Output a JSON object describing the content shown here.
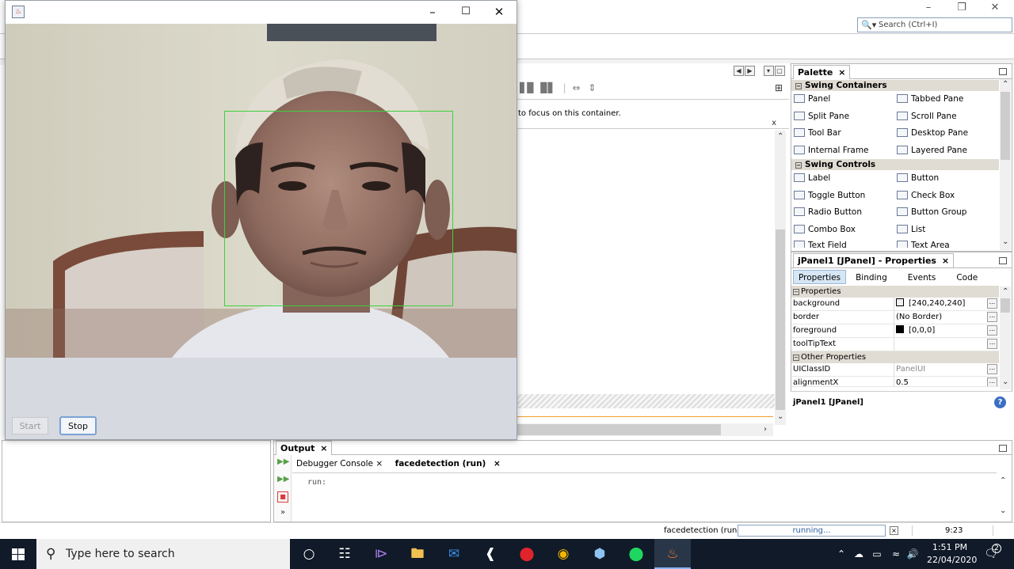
{
  "ide": {
    "search_placeholder": "Search (Ctrl+I)",
    "editor_hint": "to focus on this container.",
    "editor_hint_close": "x",
    "palette": {
      "title": "Palette",
      "close": "×",
      "categories": [
        {
          "name": "Swing Containers",
          "items": [
            "Panel",
            "Tabbed Pane",
            "Split Pane",
            "Scroll Pane",
            "Tool Bar",
            "Desktop Pane",
            "Internal Frame",
            "Layered Pane"
          ]
        },
        {
          "name": "Swing Controls",
          "items": [
            "Label",
            "Button",
            "Toggle Button",
            "Check Box",
            "Radio Button",
            "Button Group",
            "Combo Box",
            "List",
            "Text Field",
            "Text Area"
          ]
        }
      ]
    },
    "properties": {
      "title": "jPanel1 [JPanel] - Properties",
      "close": "×",
      "tabs": [
        "Properties",
        "Binding",
        "Events",
        "Code"
      ],
      "group1": "Properties",
      "rows1": [
        {
          "key": "background",
          "value": "[240,240,240]",
          "swatch": "#f0f0f0"
        },
        {
          "key": "border",
          "value": "(No Border)"
        },
        {
          "key": "foreground",
          "value": "[0,0,0]",
          "swatch": "#000000"
        },
        {
          "key": "toolTipText",
          "value": ""
        }
      ],
      "group2": "Other Properties",
      "rows2": [
        {
          "key": "UIClassID",
          "value": "PanelUI"
        },
        {
          "key": "alignmentX",
          "value": "0.5"
        }
      ],
      "footer": "jPanel1 [JPanel]",
      "dots": "..."
    },
    "output": {
      "title": "Output",
      "close": "×",
      "tabs": [
        "Debugger Console",
        "facedetection (run)"
      ],
      "text": "run:"
    },
    "status": {
      "task": "facedetection (run)",
      "progress": "running...",
      "position": "9:23"
    }
  },
  "camera_window": {
    "start_label": "Start",
    "stop_label": "Stop"
  },
  "taskbar": {
    "search_placeholder": "Type here to search",
    "time": "1:51 PM",
    "date": "22/04/2020",
    "notifications": "2"
  }
}
